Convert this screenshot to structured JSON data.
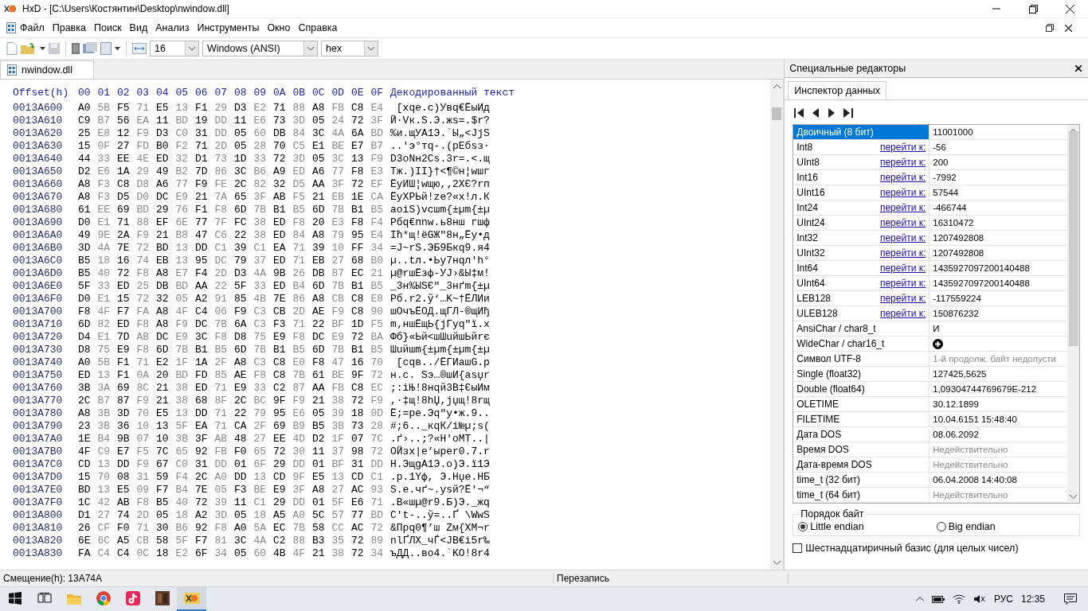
{
  "window": {
    "title": "HxD - [C:\\Users\\Костянтин\\Desktop\\nwindow.dll]"
  },
  "menu": [
    "Файл",
    "Правка",
    "Поиск",
    "Вид",
    "Анализ",
    "Инструменты",
    "Окно",
    "Справка"
  ],
  "toolbar": {
    "bytes_per_row": "16",
    "encoding": "Windows (ANSI)",
    "display": "hex"
  },
  "tabs": [
    {
      "label": "nwindow.dll",
      "selected": true
    }
  ],
  "hex_view": {
    "offset_header": "Offset(h)",
    "column_headers": [
      "00",
      "01",
      "02",
      "03",
      "04",
      "05",
      "06",
      "07",
      "08",
      "09",
      "0A",
      "0B",
      "0C",
      "0D",
      "0E",
      "0F"
    ],
    "text_header": "Декодированный текст",
    "rows": [
      {
        "offset": "0013A600",
        "bytes": "A0 5B F5 71 E5 13 F1 29 D3 E2 71 88 A8 FB C8 E4",
        "text": " [хqе.с)Увq€ЁыИд"
      },
      {
        "offset": "0013A610",
        "bytes": "C9 B7 56 EA 11 BD 19 DD 11 E6 73 3D 05 24 72 3F",
        "text": "Й·Vк.Ѕ.Э.жs=.$r?"
      },
      {
        "offset": "0013A620",
        "bytes": "25 E8 12 F9 D3 C0 31 DD 05 60 DB 84 3C 4A 6A BD",
        "text": "%и.щУА1Э.`Ы„<JjЅ"
      },
      {
        "offset": "0013A630",
        "bytes": "15 0F 27 FD B0 F2 71 2D 05 28 70 C5 E1 BE E7 B7",
        "text": "..'э°тq-.(pЕбѕз·"
      },
      {
        "offset": "0013A640",
        "bytes": "44 33 EE 4E ED 32 D1 73 1D 33 72 3D 05 3C 13 F9",
        "text": "D3оNн2Сs.3r=.<.щ"
      },
      {
        "offset": "0013A650",
        "bytes": "D2 E6 1A 29 49 B2 7D 86 3C B6 A9 ED A6 77 F8 E3",
        "text": "Тж.)IІ}†<¶©н¦wшг"
      },
      {
        "offset": "0013A660",
        "bytes": "A8 F3 C8 D8 A6 77 F9 FE 2C 82 32 D5 AA 3F 72 EF",
        "text": "ЁуИШ¦wщю,‚2ХЄ?rп"
      },
      {
        "offset": "0013A670",
        "bytes": "A8 F3 D5 D0 DC E9 21 7A 65 3F AB F5 21 EB 1E CA",
        "text": "ЁуХРЬй!ze?«х!л.К"
      },
      {
        "offset": "0013A680",
        "bytes": "61 EE 69 BD 29 76 F1 F8 6D 7B B1 B5 6D 7B B1 B5",
        "text": "aоiЅ)vсшm{±µm{±µ"
      },
      {
        "offset": "0013A690",
        "bytes": "D0 E1 71 88 EF 6E 77 7F FC 38 ED F8 20 E3 F8 F4",
        "text": "Рбq€пnw.ь8нш гшф"
      },
      {
        "offset": "0013A6A0",
        "bytes": "49 9E 2A F9 21 B8 47 C6 22 38 ED 84 A8 79 95 E4",
        "text": "Iћ*щ!ёGЖ\"8н„Ёy•д"
      },
      {
        "offset": "0013A6B0",
        "bytes": "3D 4A 7E 72 BD 13 DD C1 39 C1 EA 71 39 10 FF 34",
        "text": "=J~rЅ.ЭБ9Бкq9.я4"
      },
      {
        "offset": "0013A6C0",
        "bytes": "B5 18 16 74 EB 13 95 DC 79 37 ED 71 EB 27 68 B0",
        "text": "µ..tл.•Ьy7нqл'h°"
      },
      {
        "offset": "0013A6D0",
        "bytes": "B5 40 72 F8 A8 E7 F4 2D D3 4A 9B 26 DB 87 EC 21",
        "text": "µ@rшЁзф-УJ›&Ы‡м!"
      },
      {
        "offset": "0013A6E0",
        "bytes": "5F 33 ED 25 DB BD AA 22 5F 33 ED B4 6D 7B B1 B5",
        "text": "_3н%ЫЅЄ\"_3нґm{±µ"
      },
      {
        "offset": "0013A6F0",
        "bytes": "D0 E1 15 72 32 05 A2 91 85 4B 7E 86 A8 CB C8 E8",
        "text": "Рб.r2.ў‘…K~†ЁЛИи"
      },
      {
        "offset": "0013A700",
        "bytes": "F8 4F F7 FA A8 4F C4 06 F9 C3 CB 2D AE F9 C8 90",
        "text": "шOчъЁOД.щГЛ-®щИђ"
      },
      {
        "offset": "0013A710",
        "bytes": "6D 82 ED F8 A8 F9 DC 7B 6A C3 F3 71 22 BF 1D F5",
        "text": "m‚ншЁщЬ{jГуq\"ї.х"
      },
      {
        "offset": "0013A720",
        "bytes": "D4 E1 7D AB DC E9 3C F8 D8 75 E9 F8 DC E9 72 BA",
        "text": "Фб}«Ьй<шШuйшЬйrє"
      },
      {
        "offset": "0013A730",
        "bytes": "D8 75 E9 F8 6D 7B B1 B5 6D 7B B1 B5 6D 7B B1 B5",
        "text": "Шuйшm{±µm{±µm{±µ"
      },
      {
        "offset": "0013A740",
        "bytes": "A0 5B F1 71 E2 1F 1A 2F A8 C3 C8 E0 F8 47 16 70",
        "text": " [сqв../ЁГИашG.p"
      },
      {
        "offset": "0013A750",
        "bytes": "ED 13 F1 0A 20 BD FD 85 AE F8 C8 7B 61 BE 9F 72",
        "text": "н.с. Ѕэ…®шИ{aѕџr"
      },
      {
        "offset": "0013A760",
        "bytes": "3B 3A 69 8C 21 38 ED 71 E9 33 C2 87 AA FB C8 EC",
        "text": ";:iЊ!8нqй3В‡ЄыИм"
      },
      {
        "offset": "0013A770",
        "bytes": "2C B7 87 F9 21 38 68 8F 2C BC 9F F9 21 38 72 F9",
        "text": ",·‡щ!8hЏ,јџщ!8rщ"
      },
      {
        "offset": "0013A780",
        "bytes": "A8 3B 3D 70 E5 13 DD 71 22 79 95 E6 05 39 18 0D",
        "text": "Ё;=pе.Эq\"y•ж.9.."
      },
      {
        "offset": "0013A790",
        "bytes": "23 3B 36 10 13 5F EA 71 CA 2F 69 B9 B5 3B 73 28",
        "text": "#;6.._кqК/i№µ;s("
      },
      {
        "offset": "0013A7A0",
        "bytes": "1E B4 9B 07 10 3B 3F AB 48 27 EE 4D D2 1F 07 7C",
        "text": ".ґ›..;?«H'оMТ..|"
      },
      {
        "offset": "0013A7B0",
        "bytes": "4F C9 E7 F5 7C 65 92 FB F0 65 72 30 11 37 98 72",
        "text": "OЙзх|e’ырer0.7.r"
      },
      {
        "offset": "0013A7C0",
        "bytes": "CD 13 DD F9 67 C0 31 DD 01 6F 29 DD 01 BF 31 DD",
        "text": "Н.ЭщgА1Э.o)Э.ї1Э"
      },
      {
        "offset": "0013A7D0",
        "bytes": "15 70 08 31 59 F4 2C A0 DD 13 CD 9F E5 13 CD C1",
        "text": ".p.1Yф, Э.Нџе.НБ"
      },
      {
        "offset": "0013A7E0",
        "bytes": "BD 13 E5 09 F7 B4 7E 05 F3 BE E9 3F A8 27 AC 93",
        "text": "Ѕ.е.чґ~.уѕй?Ё'¬“"
      },
      {
        "offset": "0013A7F0",
        "bytes": "1C 42 AB F8 B5 40 72 39 11 C1 29 DD 01 5F E6 71",
        "text": ".B«шµ@r9.Б)Э._жq"
      },
      {
        "offset": "0013A800",
        "bytes": "D1 27 74 2D 05 18 A2 3D 05 18 A5 A0 5C 57 77 BD",
        "text": "С't-..ў=..Ґ \\WwЅ"
      },
      {
        "offset": "0013A810",
        "bytes": "26 CF F0 71 30 B6 92 F8 A0 5A EC 7B 58 CC AC 72",
        "text": "&Прq0¶’ш Zм{XМ¬r"
      },
      {
        "offset": "0013A820",
        "bytes": "6E 6C A5 CB 58 5F F7 81 3C 4A C2 88 B3 35 72 89",
        "text": "nlҐЛX_чЃ<JВ€і5r‰"
      },
      {
        "offset": "0013A830",
        "bytes": "FA C4 C4 0C 18 E2 6F 34 05 60 4B 4F 21 38 72 34",
        "text": "ъДД..вo4.`KO!8r4"
      }
    ]
  },
  "side_panel": {
    "title": "Специальные редакторы",
    "tabs": [
      {
        "label": "Инспектор данных",
        "selected": true
      }
    ],
    "inspector": [
      {
        "label": "Двоичный (8 бит)",
        "value": "11001000",
        "kind": "text",
        "valid": true,
        "selected": true
      },
      {
        "label": "Int8",
        "link": "перейти к:",
        "value": "-56",
        "kind": "text",
        "valid": true,
        "selected": false
      },
      {
        "label": "UInt8",
        "link": "перейти к:",
        "value": "200",
        "kind": "text",
        "valid": true,
        "selected": false
      },
      {
        "label": "Int16",
        "link": "перейти к:",
        "value": "-7992",
        "kind": "text",
        "valid": true,
        "selected": false
      },
      {
        "label": "UInt16",
        "link": "перейти к:",
        "value": "57544",
        "kind": "text",
        "valid": true,
        "selected": false
      },
      {
        "label": "Int24",
        "link": "перейти к:",
        "value": "-466744",
        "kind": "text",
        "valid": true,
        "selected": false
      },
      {
        "label": "UInt24",
        "link": "перейти к:",
        "value": "16310472",
        "kind": "text",
        "valid": true,
        "selected": false
      },
      {
        "label": "Int32",
        "link": "перейти к:",
        "value": "1207492808",
        "kind": "text",
        "valid": true,
        "selected": false
      },
      {
        "label": "UInt32",
        "link": "перейти к:",
        "value": "1207492808",
        "kind": "text",
        "valid": true,
        "selected": false
      },
      {
        "label": "Int64",
        "link": "перейти к:",
        "value": "1435927097200140488",
        "kind": "text",
        "valid": true,
        "selected": false
      },
      {
        "label": "UInt64",
        "link": "перейти к:",
        "value": "1435927097200140488",
        "kind": "text",
        "valid": true,
        "selected": false
      },
      {
        "label": "LEB128",
        "link": "перейти к:",
        "value": "-117559224",
        "kind": "text",
        "valid": true,
        "selected": false
      },
      {
        "label": "ULEB128",
        "link": "перейти к:",
        "value": "150876232",
        "kind": "text",
        "valid": true,
        "selected": false
      },
      {
        "label": "AnsiChar / char8_t",
        "value": "И",
        "kind": "text",
        "valid": true,
        "selected": false
      },
      {
        "label": "WideChar / char16_t",
        "kind": "glyph",
        "valid": true,
        "selected": false
      },
      {
        "label": "Символ UTF-8",
        "value": "1-й продолж. байт недопусти",
        "kind": "text",
        "valid": false,
        "selected": false
      },
      {
        "label": "Single (float32)",
        "value": "127425,5625",
        "kind": "text",
        "valid": true,
        "selected": false
      },
      {
        "label": "Double (float64)",
        "value": "1,09304744769679E-212",
        "kind": "text",
        "valid": true,
        "selected": false
      },
      {
        "label": "OLETIME",
        "value": "30.12.1899",
        "kind": "text",
        "valid": true,
        "selected": false
      },
      {
        "label": "FILETIME",
        "value": "10.04.6151 15:48:40",
        "kind": "text",
        "valid": true,
        "selected": false
      },
      {
        "label": "Дата DOS",
        "value": "08.06.2092",
        "kind": "text",
        "valid": true,
        "selected": false
      },
      {
        "label": "Время DOS",
        "value": "Недействительно",
        "kind": "text",
        "valid": false,
        "selected": false
      },
      {
        "label": "Дата-время DOS",
        "value": "Недействительно",
        "kind": "text",
        "valid": false,
        "selected": false
      },
      {
        "label": "time_t (32 бит)",
        "value": "06.04.2008 14:40:08",
        "kind": "text",
        "valid": true,
        "selected": false
      },
      {
        "label": "time_t (64 бит)",
        "value": "Недействительно",
        "kind": "text",
        "valid": false,
        "selected": false
      }
    ],
    "byte_order": {
      "title": "Порядок байт",
      "options": [
        {
          "label": "Little endian",
          "selected": true
        },
        {
          "label": "Big endian",
          "selected": false
        }
      ]
    },
    "hex_base": {
      "label": "Шестнадцатиричный базис (для целых чисел)",
      "checked": false
    }
  },
  "status_bar": {
    "offset": "Смещение(h): 13A74A",
    "mode": "Перезапись"
  },
  "taskbar": {
    "apps": [
      {
        "kind": "start",
        "selected": false
      },
      {
        "kind": "taskview",
        "selected": false
      },
      {
        "kind": "folder",
        "selected": false
      },
      {
        "kind": "browser",
        "selected": false
      },
      {
        "kind": "note",
        "selected": false
      },
      {
        "kind": "app",
        "selected": false
      },
      {
        "kind": "hxd",
        "selected": true
      }
    ],
    "language": "РУС",
    "time": "12:35"
  }
}
